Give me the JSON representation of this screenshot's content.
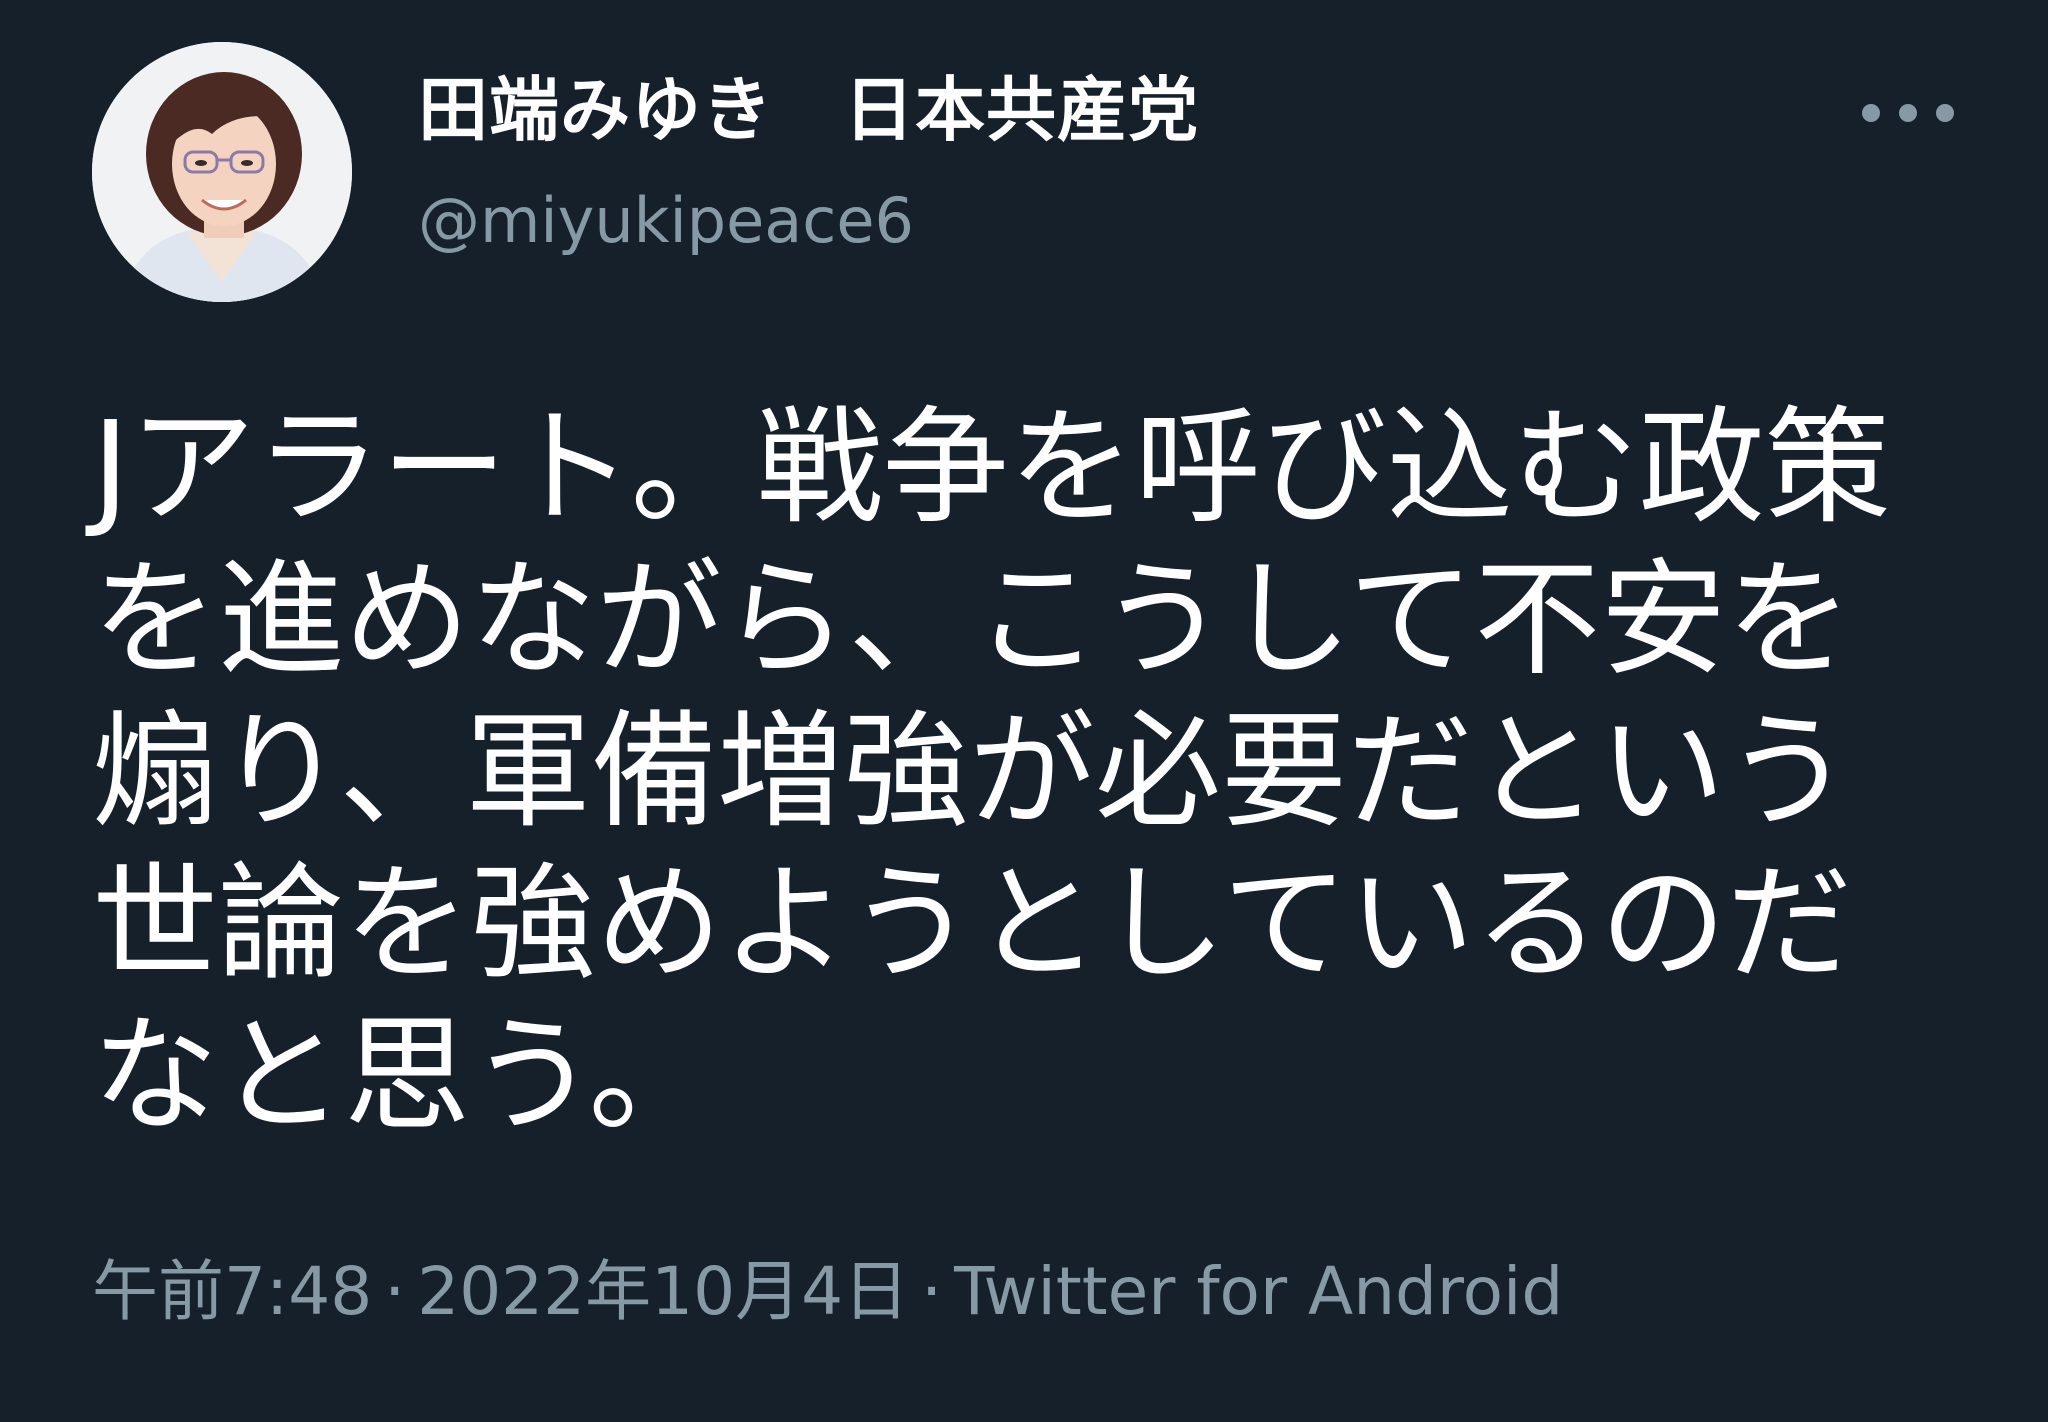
{
  "author": {
    "display_name": "田端みゆき　日本共産党",
    "handle": "@miyukipeace6",
    "avatar_icon": "profile-photo"
  },
  "actions": {
    "more_icon": "more-horizontal-icon"
  },
  "tweet": {
    "lines": [
      "Jアラート。戦争を呼び込む政策",
      "を進めながら、こうして不安を",
      "煽り、軍備増強が必要だという",
      "世論を強めようとしているのだ",
      "なと思う。"
    ]
  },
  "meta": {
    "time": "午前7:48",
    "separator": "·",
    "date": "2022年10月4日",
    "source": "Twitter for Android"
  },
  "colors": {
    "background": "#15202b",
    "text": "#ffffff",
    "secondary": "#8899a6"
  }
}
